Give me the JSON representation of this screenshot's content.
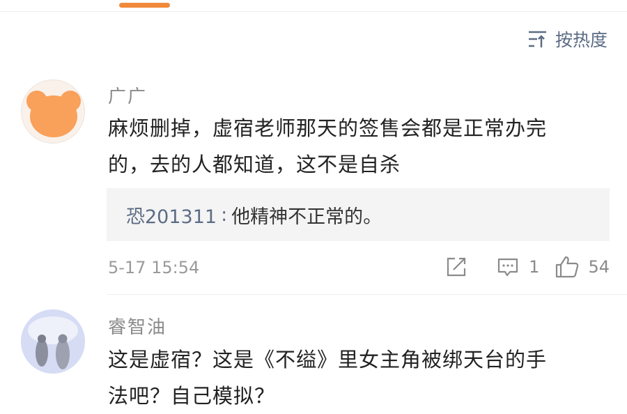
{
  "sort": {
    "label": "按热度"
  },
  "comments": [
    {
      "author": "广广",
      "text_line1": "麻烦删掉，虚宿老师那天的签售会都是正常办完",
      "text_line2": "的，去的人都知道，这不是自杀",
      "reply": {
        "user": "恐201311",
        "separator": ":",
        "text": "他精神不正常的。"
      },
      "time": "5-17 15:54",
      "reply_count": "1",
      "like_count": "54"
    },
    {
      "author": "睿智油",
      "text_line1": "这是虚宿？这是《不缢》里女主角被绑天台的手",
      "text_line2": "法吧？自己模拟？"
    }
  ],
  "colors": {
    "accent": "#f08a3a",
    "link": "#5c6c85",
    "avatar1": "#f9a05a"
  }
}
